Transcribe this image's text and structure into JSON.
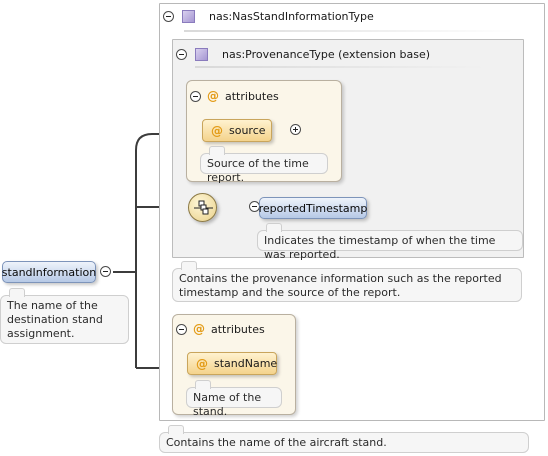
{
  "root_element": {
    "name": "standInformation",
    "documentation": "The name of the destination stand assignment."
  },
  "type": {
    "name": "nas:NasStandInformationType",
    "documentation": "Contains the name of the aircraft stand.",
    "base": {
      "name": "nas:ProvenanceType (extension base)",
      "documentation": "Contains the provenance information such as the reported timestamp and the source of the report.",
      "attributes": {
        "label": "attributes",
        "items": [
          {
            "name": "source",
            "documentation": "Source of the time report."
          }
        ]
      },
      "sequence": {
        "elements": [
          {
            "name": "reportedTimestamp",
            "documentation": "Indicates the timestamp of when the time was reported."
          }
        ]
      }
    },
    "attributes": {
      "label": "attributes",
      "items": [
        {
          "name": "standName",
          "documentation": "Name of the stand."
        }
      ]
    }
  },
  "symbols": {
    "attribute_marker": "@"
  },
  "icons": {
    "collapse": "collapse-icon",
    "expand": "expand-icon",
    "complex_type": "complex-type-icon",
    "sequence": "sequence-compositor-icon"
  },
  "colors": {
    "element_fill": "#b6c9e6",
    "attribute_fill": "#f4d38c",
    "attribute_group_fill": "#fbf6e9",
    "type_icon": "#a697d2",
    "connector": "#3c3c3c"
  }
}
